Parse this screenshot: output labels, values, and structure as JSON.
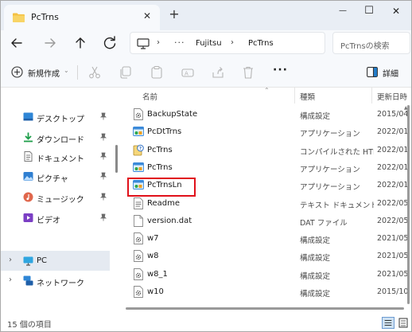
{
  "window": {
    "tab_title": "PcTrns",
    "tab_close": "✕",
    "new_tab": "+",
    "minimize": "—",
    "maximize": "☐",
    "close": "✕"
  },
  "address": {
    "more": "···",
    "crumbs": [
      "Fujitsu",
      "PcTrns"
    ],
    "chevron": "›",
    "search_placeholder": "PcTrnsの検索"
  },
  "commandbar": {
    "new_label": "新規作成",
    "more": "···",
    "details_label": "詳細"
  },
  "sidebar": {
    "quick_access": [
      {
        "label": "デスクトップ",
        "icon": "desktop-icon",
        "pinned": true
      },
      {
        "label": "ダウンロード",
        "icon": "download-icon",
        "pinned": true
      },
      {
        "label": "ドキュメント",
        "icon": "documents-icon",
        "pinned": true
      },
      {
        "label": "ピクチャ",
        "icon": "pictures-icon",
        "pinned": true
      },
      {
        "label": "ミュージック",
        "icon": "music-icon",
        "pinned": true
      },
      {
        "label": "ビデオ",
        "icon": "videos-icon",
        "pinned": true
      }
    ],
    "pc_label": "PC",
    "network_label": "ネットワーク",
    "chevron": "›"
  },
  "columns": {
    "name": "名前",
    "type": "種類",
    "date": "更新日時"
  },
  "files": [
    {
      "name": "BackupState",
      "type": "構成設定",
      "date": "2015/04",
      "icon": "settings-file-icon"
    },
    {
      "name": "PcDtTrns",
      "type": "アプリケーション",
      "date": "2022/01",
      "icon": "app-icon"
    },
    {
      "name": "PcTrns",
      "type": "コンパイルされた HTML",
      "date": "2022/01",
      "icon": "chm-file-icon"
    },
    {
      "name": "PcTrns",
      "type": "アプリケーション",
      "date": "2022/01",
      "icon": "app-icon"
    },
    {
      "name": "PcTrnsLn",
      "type": "アプリケーション",
      "date": "2022/01",
      "icon": "app-icon"
    },
    {
      "name": "Readme",
      "type": "テキスト ドキュメント",
      "date": "2022/05",
      "icon": "text-file-icon"
    },
    {
      "name": "version.dat",
      "type": "DAT ファイル",
      "date": "2022/05",
      "icon": "blank-file-icon"
    },
    {
      "name": "w7",
      "type": "構成設定",
      "date": "2021/05",
      "icon": "settings-file-icon"
    },
    {
      "name": "w8",
      "type": "構成設定",
      "date": "2021/05",
      "icon": "settings-file-icon"
    },
    {
      "name": "w8_1",
      "type": "構成設定",
      "date": "2021/05",
      "icon": "settings-file-icon"
    },
    {
      "name": "w10",
      "type": "構成設定",
      "date": "2015/10",
      "icon": "settings-file-icon"
    }
  ],
  "status": {
    "item_count": "15 個の項目"
  },
  "colors": {
    "accent": "#0067c0",
    "highlight_box": "#e0101a",
    "selected_nav": "#e5eaf1",
    "folder": "#f4c142"
  }
}
